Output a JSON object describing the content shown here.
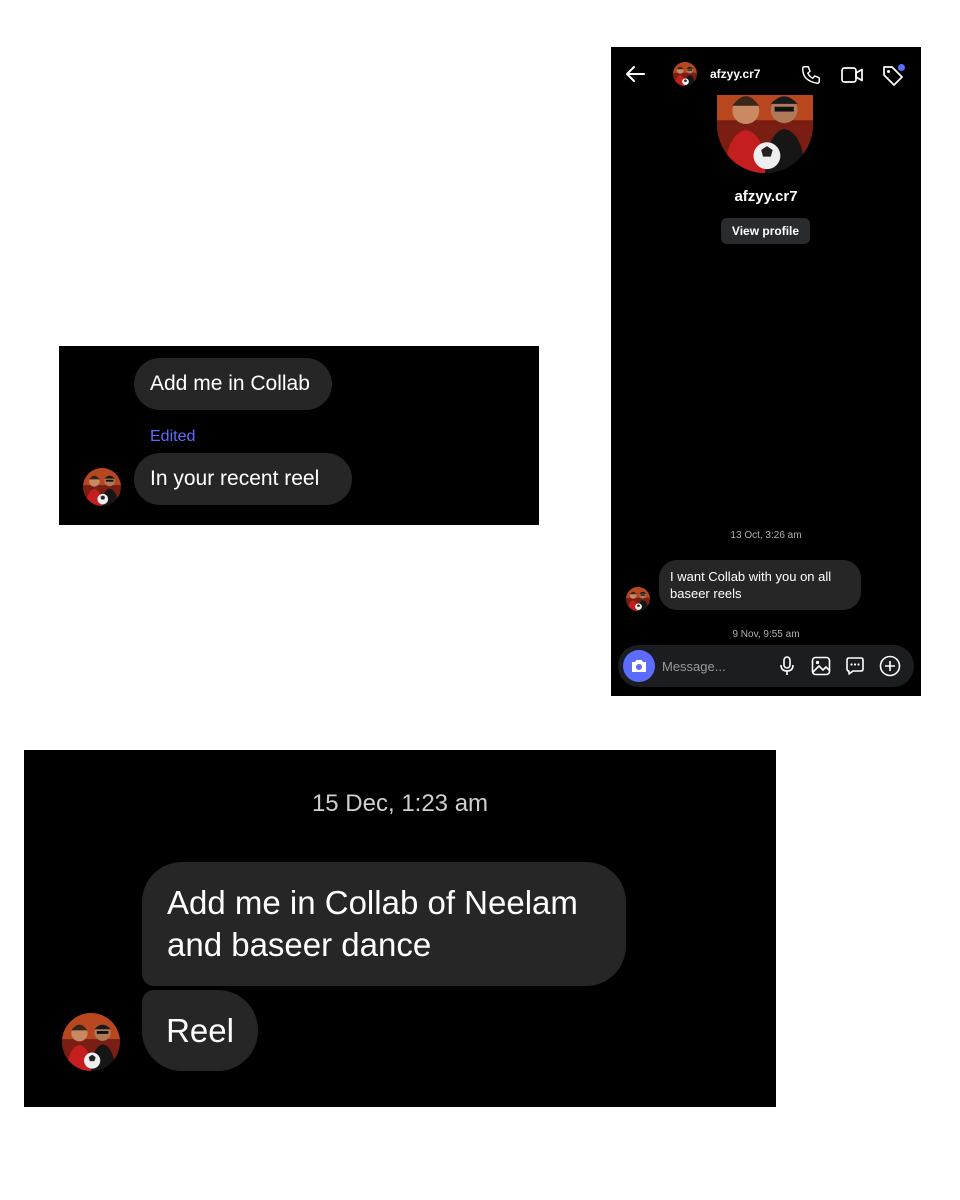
{
  "phone": {
    "header": {
      "back_icon": "arrow-left-icon",
      "username": "afzyy.cr7",
      "actions": [
        "phone-icon",
        "video-icon",
        "tag-icon"
      ]
    },
    "profile": {
      "name": "afzyy.cr7",
      "view_profile_label": "View profile"
    },
    "thread": [
      {
        "type": "timestamp",
        "text": "13 Oct, 3:26 am"
      },
      {
        "type": "message",
        "text": "I want Collab with you on all baseer reels"
      },
      {
        "type": "timestamp",
        "text": "9 Nov, 9:55 am"
      }
    ],
    "composer": {
      "placeholder": "Message...",
      "actions": [
        "camera-icon",
        "microphone-icon",
        "image-icon",
        "sticker-icon",
        "add-icon"
      ]
    }
  },
  "crop_middle": {
    "messages": [
      {
        "text": "Add me in Collab"
      },
      {
        "text": "In your recent reel",
        "label": "Edited"
      }
    ]
  },
  "crop_bottom": {
    "timestamp": "15 Dec, 1:23 am",
    "messages": [
      {
        "text": "Add me in Collab of Neelam and baseer dance"
      },
      {
        "text": "Reel"
      }
    ]
  },
  "colors": {
    "background": "#000000",
    "bubble": "#262626",
    "accent": "#5b6cff",
    "page": "#ffffff"
  }
}
